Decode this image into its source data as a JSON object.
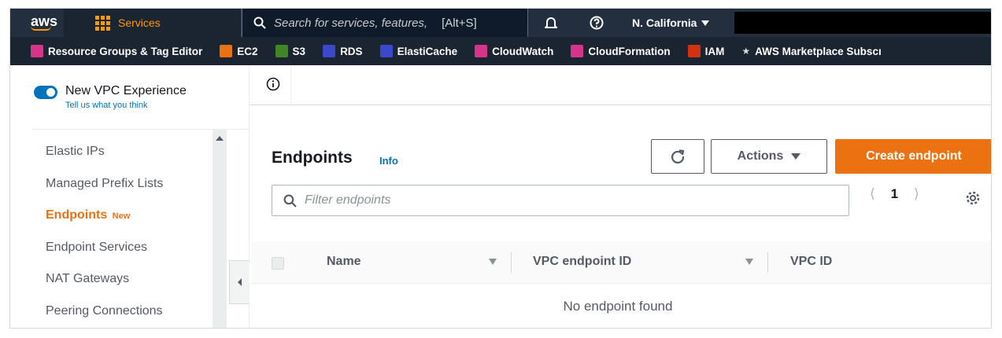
{
  "topnav": {
    "logo_text": "aws",
    "services_label": "Services",
    "search_placeholder": "Search for services, features,",
    "search_shortcut": "[Alt+S]",
    "region": "N. California"
  },
  "favorites": [
    {
      "label": "Resource Groups & Tag Editor",
      "color": "#d6338a"
    },
    {
      "label": "EC2",
      "color": "#ec7211"
    },
    {
      "label": "S3",
      "color": "#3f8624"
    },
    {
      "label": "RDS",
      "color": "#3b48cc"
    },
    {
      "label": "ElastiCache",
      "color": "#3b48cc"
    },
    {
      "label": "CloudWatch",
      "color": "#d6338a"
    },
    {
      "label": "CloudFormation",
      "color": "#d6338a"
    },
    {
      "label": "IAM",
      "color": "#d13212"
    },
    {
      "label": "AWS Marketplace Subscı",
      "color": "#1b2532"
    }
  ],
  "sidebar": {
    "toggle_label": "New VPC Experience",
    "toggle_sub": "Tell us what you think",
    "items": [
      {
        "label": "Elastic IPs"
      },
      {
        "label": "Managed Prefix Lists"
      },
      {
        "label": "Endpoints",
        "badge": "New"
      },
      {
        "label": "Endpoint Services"
      },
      {
        "label": "NAT Gateways"
      },
      {
        "label": "Peering Connections"
      }
    ]
  },
  "main": {
    "title": "Endpoints",
    "info_link": "Info",
    "actions_label": "Actions",
    "create_label": "Create endpoint",
    "filter_placeholder": "Filter endpoints",
    "page_number": "1",
    "columns": [
      "Name",
      "VPC endpoint ID",
      "VPC ID"
    ],
    "empty_message": "No endpoint found"
  },
  "colors": {
    "nav_bg": "#232f3e",
    "accent": "#ec7211",
    "link": "#0073bb"
  }
}
